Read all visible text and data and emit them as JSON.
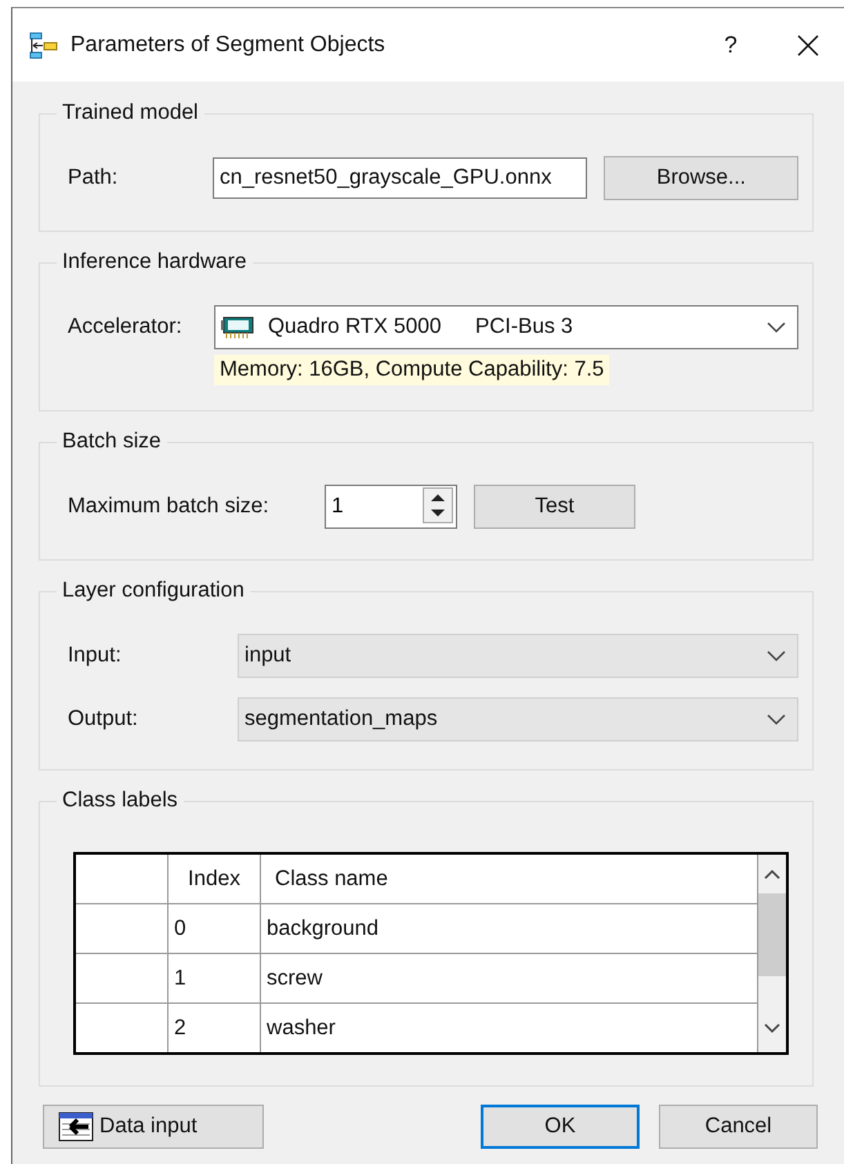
{
  "window": {
    "title": "Parameters of Segment Objects",
    "help": "?"
  },
  "trained_model": {
    "title": "Trained model",
    "label": "Path:",
    "value": "cn_resnet50_grayscale_GPU.onnx",
    "button": "Browse..."
  },
  "inference_hardware": {
    "title": "Inference hardware",
    "label": "Accelerator:",
    "device": "Quadro RTX 5000",
    "bus": "PCI-Bus 3",
    "info": "Memory: 16GB, Compute Capability: 7.5"
  },
  "batch_size": {
    "title": "Batch size",
    "label": "Maximum batch size:",
    "value": "1",
    "button": "Test"
  },
  "layer_configuration": {
    "title": "Layer configuration",
    "fields": [
      {
        "label": "Input:",
        "value": "input"
      },
      {
        "label": "Output:",
        "value": "segmentation_maps"
      }
    ]
  },
  "class_labels": {
    "title": "Class labels",
    "columns": [
      "Index",
      "Class name"
    ],
    "rows": [
      {
        "index": "0",
        "name": "background"
      },
      {
        "index": "1",
        "name": "screw"
      },
      {
        "index": "2",
        "name": "washer"
      }
    ]
  },
  "buttons": {
    "data_input": "Data input",
    "ok": "OK",
    "cancel": "Cancel"
  }
}
